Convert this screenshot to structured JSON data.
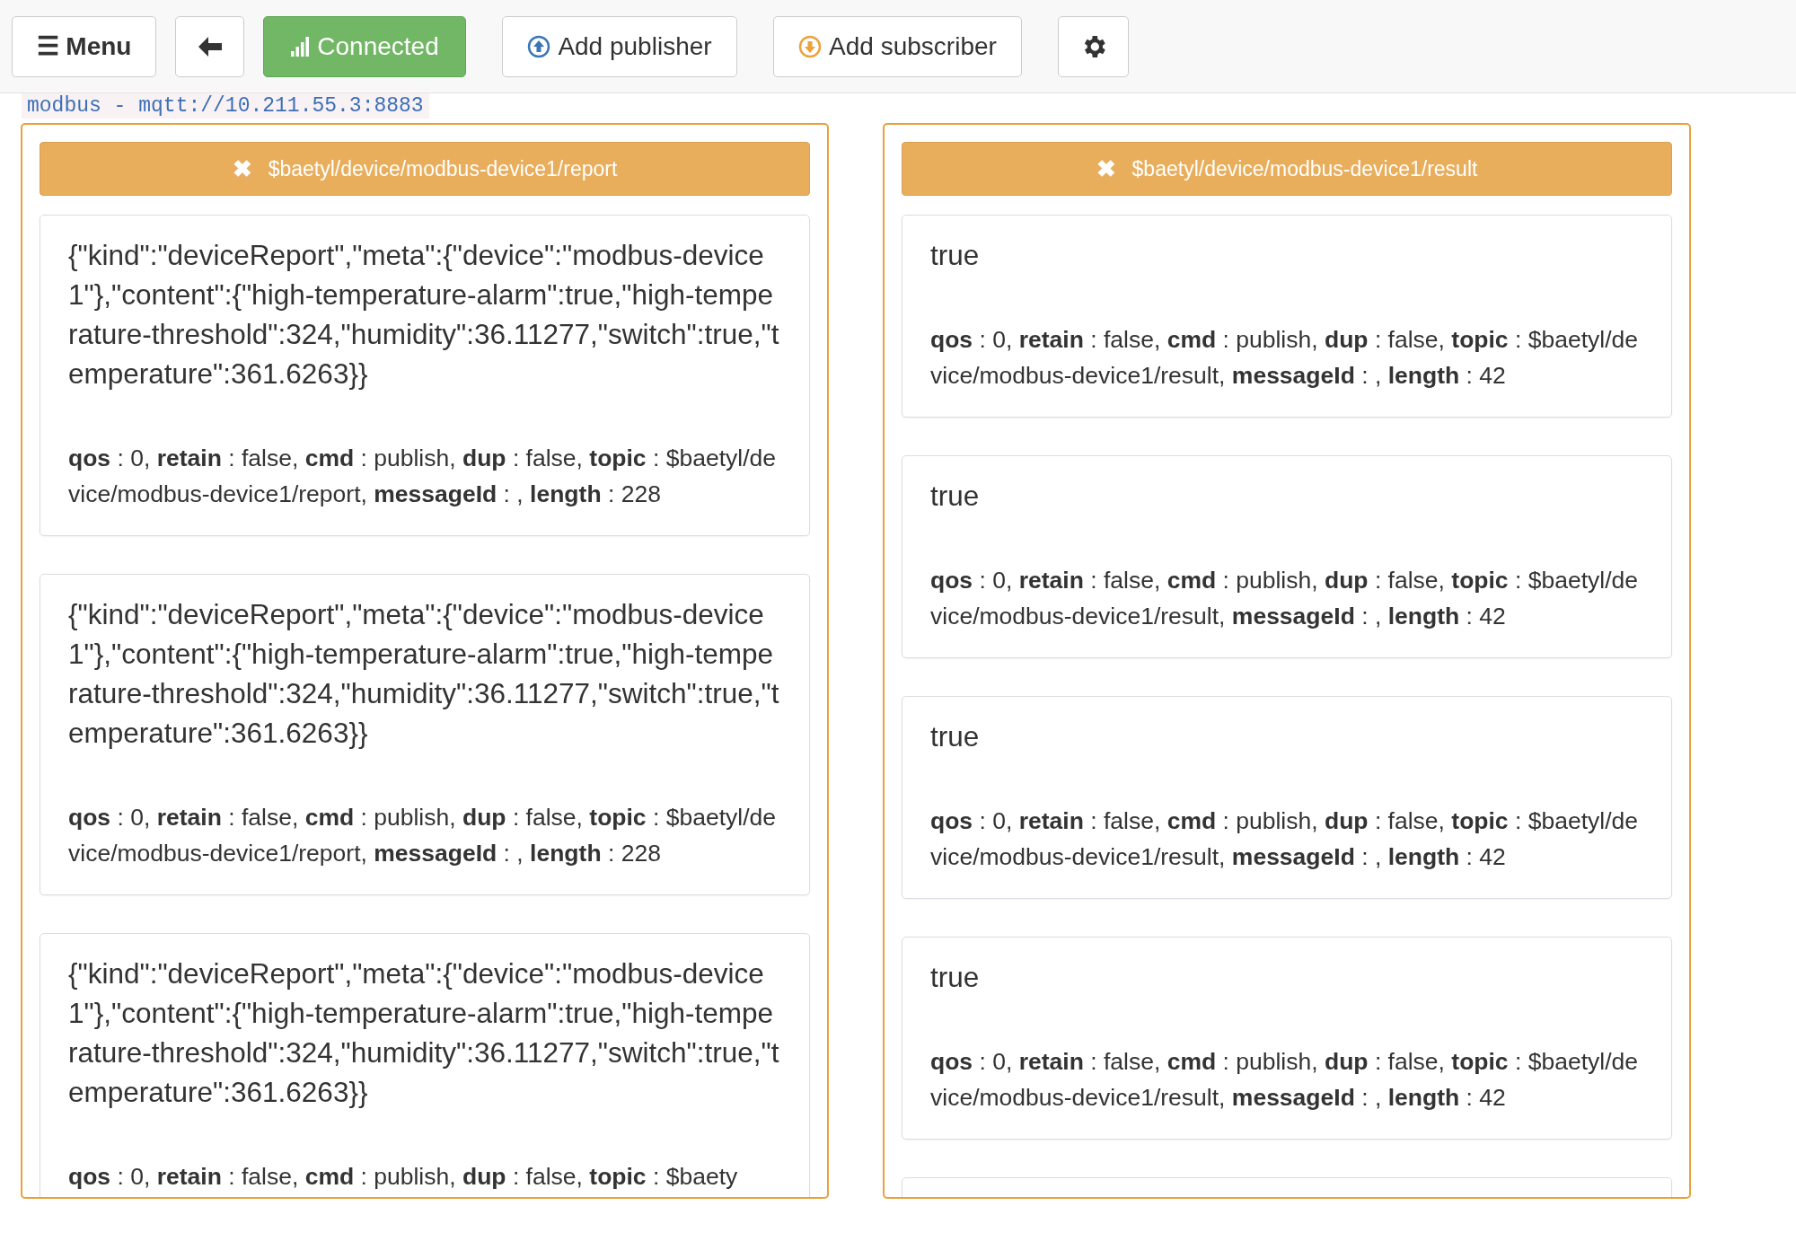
{
  "toolbar": {
    "menu": "☰ Menu",
    "connection": {
      "label": "Connected",
      "connected": true
    },
    "add_publisher": "Add publisher",
    "add_subscriber": "Add subscriber"
  },
  "connection_label": "modbus - mqtt://10.211.55.3:8883",
  "panels": [
    {
      "topic": "$baetyl/device/modbus-device1/report",
      "close": "✖",
      "messages": [
        {
          "payload": "{\"kind\":\"deviceReport\",\"meta\":{\"device\":\"modbus-device1\"},\"content\":{\"high-temperature-alarm\":true,\"high-temperature-threshold\":324,\"humidity\":36.11277,\"switch\":true,\"temperature\":361.6263}}",
          "meta": "**qos** : 0, **retain** : false, **cmd** : publish, **dup** : false, **topic** : $baetyl/device/modbus-device1/report, **messageId** : , **length** : 228"
        },
        {
          "payload": "{\"kind\":\"deviceReport\",\"meta\":{\"device\":\"modbus-device1\"},\"content\":{\"high-temperature-alarm\":true,\"high-temperature-threshold\":324,\"humidity\":36.11277,\"switch\":true,\"temperature\":361.6263}}",
          "meta": "**qos** : 0, **retain** : false, **cmd** : publish, **dup** : false, **topic** : $baetyl/device/modbus-device1/report, **messageId** : , **length** : 228"
        },
        {
          "payload": "{\"kind\":\"deviceReport\",\"meta\":{\"device\":\"modbus-device1\"},\"content\":{\"high-temperature-alarm\":true,\"high-temperature-threshold\":324,\"humidity\":36.11277,\"switch\":true,\"temperature\":361.6263}}",
          "meta": "**qos** : 0, **retain** : false, **cmd** : publish, **dup** : false, **topic** : $baety"
        }
      ]
    },
    {
      "topic": "$baetyl/device/modbus-device1/result",
      "close": "✖",
      "more_below": true,
      "messages": [
        {
          "payload": "true",
          "meta": "**qos** : 0, **retain** : false, **cmd** : publish, **dup** : false, **topic** : $baetyl/device/modbus-device1/result, **messageId** : , **length** : 42"
        },
        {
          "payload": "true",
          "meta": "**qos** : 0, **retain** : false, **cmd** : publish, **dup** : false, **topic** : $baetyl/device/modbus-device1/result, **messageId** : , **length** : 42"
        },
        {
          "payload": "true",
          "meta": "**qos** : 0, **retain** : false, **cmd** : publish, **dup** : false, **topic** : $baetyl/device/modbus-device1/result, **messageId** : , **length** : 42"
        },
        {
          "payload": "true",
          "meta": "**qos** : 0, **retain** : false, **cmd** : publish, **dup** : false, **topic** : $baetyl/device/modbus-device1/result, **messageId** : , **length** : 42"
        }
      ]
    }
  ]
}
